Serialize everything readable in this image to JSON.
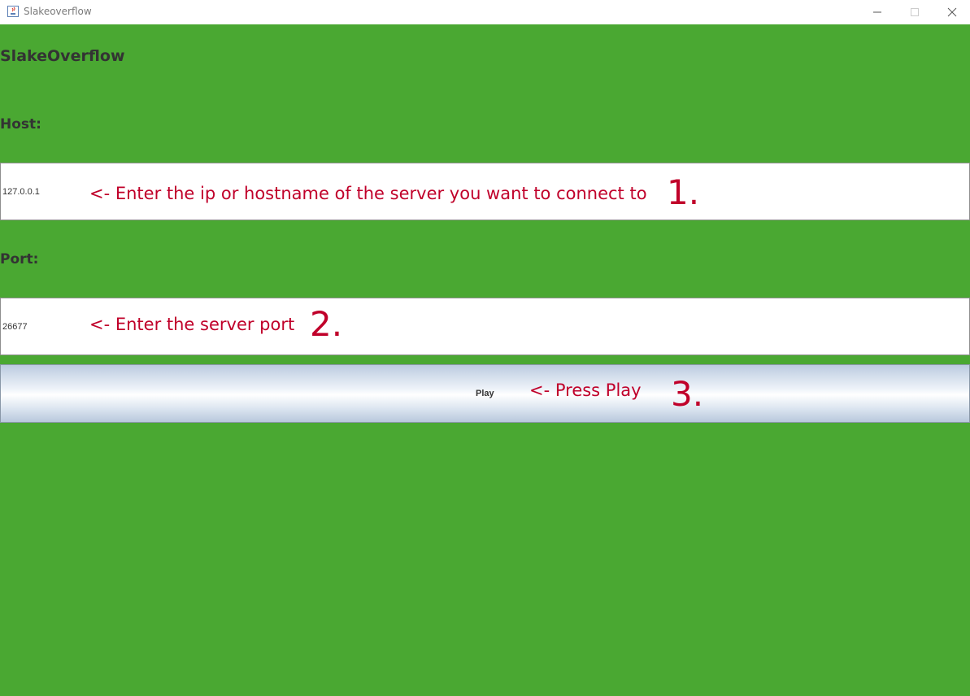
{
  "window": {
    "title": "Slakeoverflow",
    "controls": {
      "minimize_icon": "minimize-icon",
      "maximize_icon": "maximize-icon",
      "close_icon": "close-icon"
    }
  },
  "app": {
    "title": "SlakeOverflow",
    "background_color": "#4aa832"
  },
  "host": {
    "label": "Host:",
    "value": "127.0.0.1"
  },
  "port": {
    "label": "Port:",
    "value": "26677"
  },
  "play": {
    "label": "Play"
  },
  "annotations": {
    "color": "#c0002a",
    "step1": {
      "text": "<- Enter the ip or hostname of the server you want to connect to",
      "number": "1."
    },
    "step2": {
      "text": "<- Enter the server port",
      "number": "2."
    },
    "step3": {
      "text": "<- Press Play",
      "number": "3."
    }
  }
}
